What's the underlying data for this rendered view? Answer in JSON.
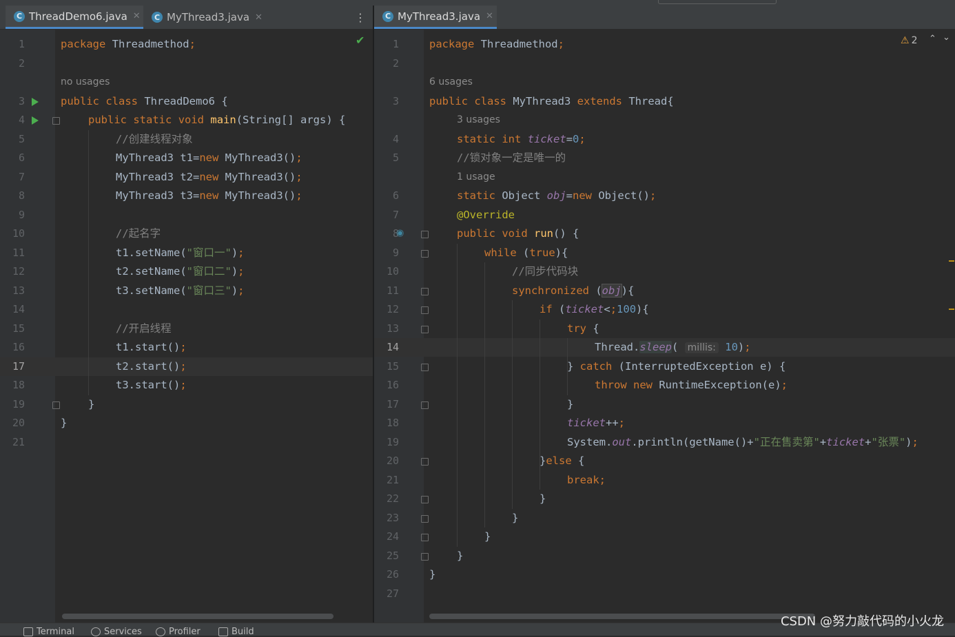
{
  "left": {
    "tabs": [
      {
        "label": "ThreadDemo6.java",
        "active": true
      },
      {
        "label": "MyThread3.java",
        "active": false
      }
    ],
    "file_icon": "C",
    "close_glyph": "✕",
    "more_glyph": "⋮",
    "check_glyph": "✔",
    "hints": {
      "no_usages": "no usages"
    },
    "lines": [
      {
        "n": "1",
        "code": "package Threadmethod;"
      },
      {
        "n": "2",
        "code": ""
      },
      {
        "n": "3",
        "code": "public class ThreadDemo6 {"
      },
      {
        "n": "4",
        "code": "public static void main(String[] args) {"
      },
      {
        "n": "5",
        "code": "//创建线程对象"
      },
      {
        "n": "6",
        "code": "MyThread3 t1=new MyThread3();"
      },
      {
        "n": "7",
        "code": "MyThread3 t2=new MyThread3();"
      },
      {
        "n": "8",
        "code": "MyThread3 t3=new MyThread3();"
      },
      {
        "n": "9",
        "code": ""
      },
      {
        "n": "10",
        "code": "//起名字"
      },
      {
        "n": "11",
        "code": "t1.setName(\"窗口一\");"
      },
      {
        "n": "12",
        "code": "t2.setName(\"窗口二\");"
      },
      {
        "n": "13",
        "code": "t3.setName(\"窗口三\");"
      },
      {
        "n": "14",
        "code": ""
      },
      {
        "n": "15",
        "code": "//开启线程"
      },
      {
        "n": "16",
        "code": "t1.start();"
      },
      {
        "n": "17",
        "code": "t2.start();"
      },
      {
        "n": "18",
        "code": "t3.start();"
      },
      {
        "n": "19",
        "code": "}"
      },
      {
        "n": "20",
        "code": "}"
      },
      {
        "n": "21",
        "code": ""
      }
    ],
    "current_line": "17"
  },
  "right": {
    "tabs": [
      {
        "label": "MyThread3.java",
        "active": true
      }
    ],
    "warnings": {
      "count": "2",
      "triangle": "⚠",
      "up": "⌃",
      "down": "⌄"
    },
    "hints": {
      "six_usages": "6 usages",
      "three_usages": "3 usages",
      "one_usage": "1 usage",
      "param_name": "millis:"
    },
    "lines": [
      {
        "n": "1",
        "code": "package Threadmethod;"
      },
      {
        "n": "2",
        "code": ""
      },
      {
        "n": "3",
        "code": "public class MyThread3 extends Thread{"
      },
      {
        "n": "4",
        "code": "static int ticket=0;"
      },
      {
        "n": "5",
        "code": "//锁对象一定是唯一的"
      },
      {
        "n": "6",
        "code": "static Object obj=new Object();"
      },
      {
        "n": "7",
        "code": "@Override"
      },
      {
        "n": "8",
        "code": "public void run() {"
      },
      {
        "n": "9",
        "code": "while (true){"
      },
      {
        "n": "10",
        "code": "//同步代码块"
      },
      {
        "n": "11",
        "code": "synchronized (obj){"
      },
      {
        "n": "12",
        "code": "if (ticket<100){"
      },
      {
        "n": "13",
        "code": "try {"
      },
      {
        "n": "14",
        "code": "Thread.sleep( millis: 10);"
      },
      {
        "n": "15",
        "code": "} catch (InterruptedException e) {"
      },
      {
        "n": "16",
        "code": "throw new RuntimeException(e);"
      },
      {
        "n": "17",
        "code": "}"
      },
      {
        "n": "18",
        "code": "ticket++;"
      },
      {
        "n": "19",
        "code": "System.out.println(getName()+\"正在售卖第\"+ticket+\"张票\");"
      },
      {
        "n": "20",
        "code": "}else {"
      },
      {
        "n": "21",
        "code": "break;"
      },
      {
        "n": "22",
        "code": "}"
      },
      {
        "n": "23",
        "code": "}"
      },
      {
        "n": "24",
        "code": "}"
      },
      {
        "n": "25",
        "code": "}"
      },
      {
        "n": "26",
        "code": "}"
      },
      {
        "n": "27",
        "code": ""
      }
    ],
    "current_line": "14"
  },
  "bottom_bar": [
    {
      "label": "Terminal",
      "icon": "terminal-icon"
    },
    {
      "label": "Services",
      "icon": "services-icon"
    },
    {
      "label": "Profiler",
      "icon": "profiler-icon"
    },
    {
      "label": "Build",
      "icon": "build-icon"
    }
  ],
  "watermark": "CSDN @努力敲代码的小火龙",
  "colors": {
    "background": "#2b2b2b",
    "keyword": "#cc7832",
    "string": "#6a8759",
    "number": "#6897bb",
    "comment": "#808080",
    "field": "#9876aa",
    "method": "#ffc66d",
    "annotation": "#bbb529",
    "tab_accent": "#4a88c7"
  }
}
